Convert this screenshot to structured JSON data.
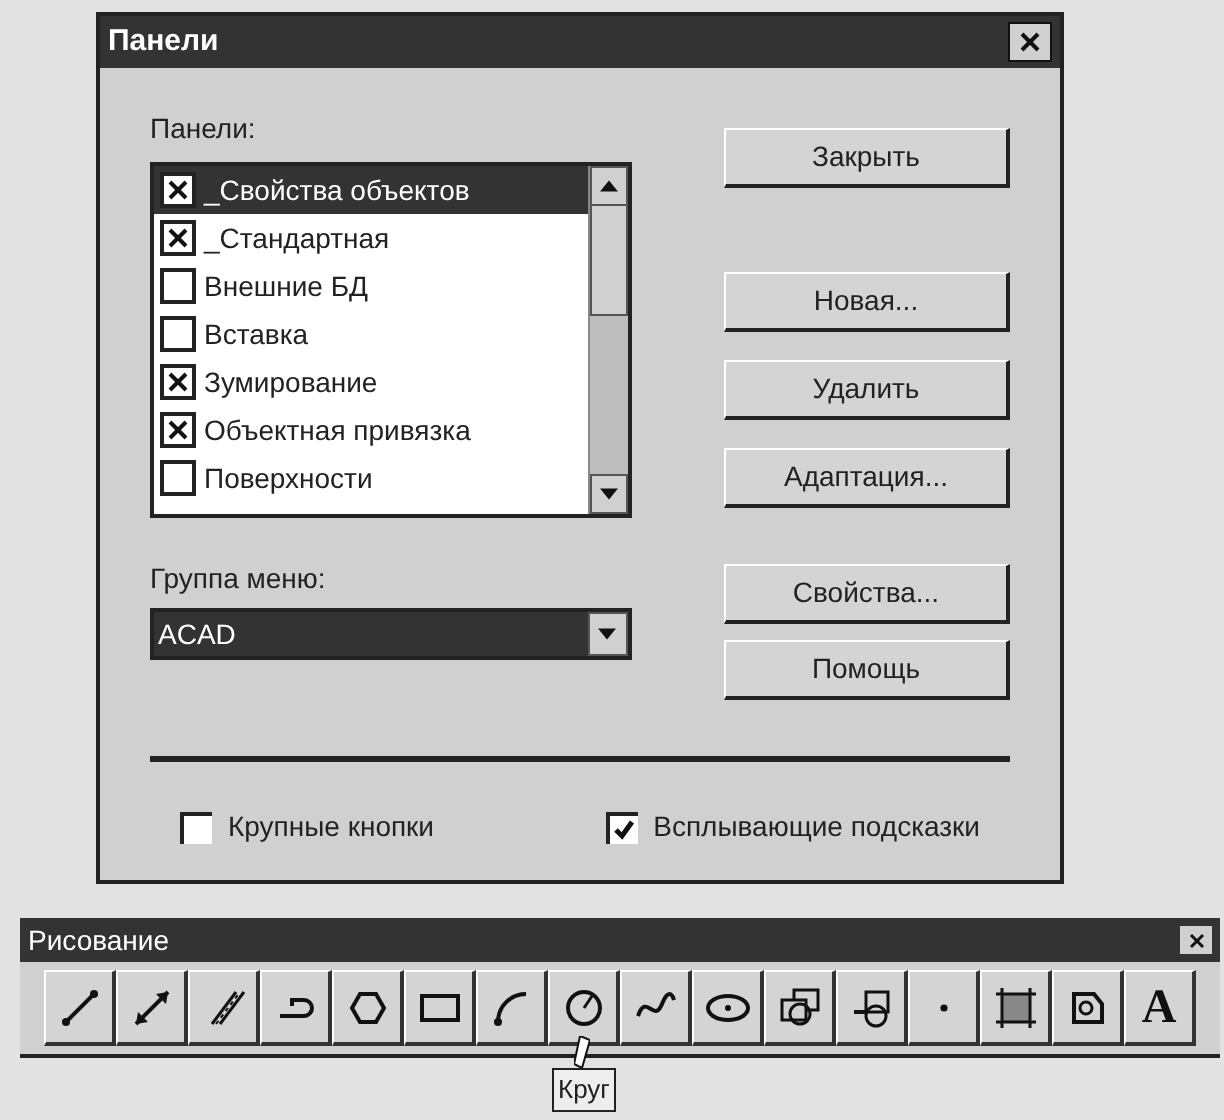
{
  "dialog": {
    "title": "Панели",
    "panels_label": "Панели:",
    "panels": [
      {
        "label": "_Свойства объектов",
        "checked": true,
        "selected": true
      },
      {
        "label": "_Стандартная",
        "checked": true,
        "selected": false
      },
      {
        "label": "Внешние БД",
        "checked": false,
        "selected": false
      },
      {
        "label": "Вставка",
        "checked": false,
        "selected": false
      },
      {
        "label": "Зумирование",
        "checked": true,
        "selected": false
      },
      {
        "label": "Объектная привязка",
        "checked": true,
        "selected": false
      },
      {
        "label": "Поверхности",
        "checked": false,
        "selected": false
      }
    ],
    "menu_group_label": "Группа меню:",
    "menu_group": {
      "value": "ACAD",
      "selected": true
    },
    "buttons": [
      "Закрыть",
      "Новая...",
      "Удалить",
      "Адаптация...",
      "Свойства...",
      "Помощь"
    ],
    "options": [
      {
        "label": "Крупные кнопки",
        "checked": false
      },
      {
        "label": "Всплывающие подсказки",
        "checked": true
      }
    ]
  },
  "toolbar": {
    "title": "Рисование",
    "tools": [
      {
        "kind": "line"
      },
      {
        "kind": "xline"
      },
      {
        "kind": "mline"
      },
      {
        "kind": "polyline"
      },
      {
        "kind": "polygon"
      },
      {
        "kind": "rectangle"
      },
      {
        "kind": "arc"
      },
      {
        "kind": "circle",
        "hovered": true
      },
      {
        "kind": "spline"
      },
      {
        "kind": "ellipse"
      },
      {
        "kind": "block"
      },
      {
        "kind": "insert"
      },
      {
        "kind": "point"
      },
      {
        "kind": "hatch"
      },
      {
        "kind": "region"
      },
      {
        "kind": "text",
        "label": "A"
      }
    ],
    "tooltip": "Круг"
  }
}
